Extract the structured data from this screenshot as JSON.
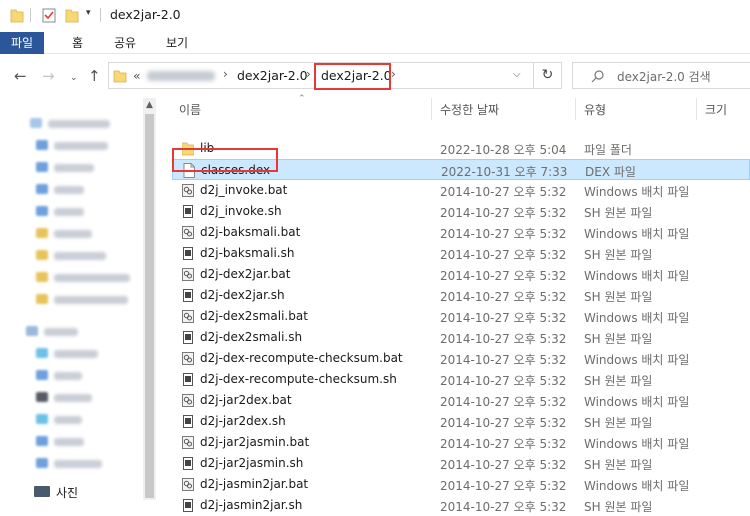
{
  "window": {
    "title": "dex2jar-2.0"
  },
  "ribbon": {
    "tabs": [
      "파일",
      "홈",
      "공유",
      "보기"
    ]
  },
  "address": {
    "crumbs": [
      "dex2jar-2.0",
      "dex2jar-2.0"
    ],
    "overflow_glyph": "«",
    "search_placeholder": "dex2jar-2.0 검색"
  },
  "columns": {
    "name": "이름",
    "date": "수정한 날짜",
    "type": "유형",
    "size": "크기"
  },
  "navpane": {
    "visible_label": "사진",
    "blurred_entries": 16
  },
  "files": [
    {
      "name": "lib",
      "date": "2022-10-28 오후 5:04",
      "type": "파일 폴더",
      "icon": "folder-icon"
    },
    {
      "name": "classes.dex",
      "date": "2022-10-31 오후 7:33",
      "type": "DEX 파일",
      "icon": "document-icon",
      "selected": true
    },
    {
      "name": "d2j_invoke.bat",
      "date": "2014-10-27 오후 5:32",
      "type": "Windows 배치 파일",
      "icon": "batch-file-icon"
    },
    {
      "name": "d2j_invoke.sh",
      "date": "2014-10-27 오후 5:32",
      "type": "SH 원본 파일",
      "icon": "script-file-icon"
    },
    {
      "name": "d2j-baksmali.bat",
      "date": "2014-10-27 오후 5:32",
      "type": "Windows 배치 파일",
      "icon": "batch-file-icon"
    },
    {
      "name": "d2j-baksmali.sh",
      "date": "2014-10-27 오후 5:32",
      "type": "SH 원본 파일",
      "icon": "script-file-icon"
    },
    {
      "name": "d2j-dex2jar.bat",
      "date": "2014-10-27 오후 5:32",
      "type": "Windows 배치 파일",
      "icon": "batch-file-icon"
    },
    {
      "name": "d2j-dex2jar.sh",
      "date": "2014-10-27 오후 5:32",
      "type": "SH 원본 파일",
      "icon": "script-file-icon"
    },
    {
      "name": "d2j-dex2smali.bat",
      "date": "2014-10-27 오후 5:32",
      "type": "Windows 배치 파일",
      "icon": "batch-file-icon"
    },
    {
      "name": "d2j-dex2smali.sh",
      "date": "2014-10-27 오후 5:32",
      "type": "SH 원본 파일",
      "icon": "script-file-icon"
    },
    {
      "name": "d2j-dex-recompute-checksum.bat",
      "date": "2014-10-27 오후 5:32",
      "type": "Windows 배치 파일",
      "icon": "batch-file-icon"
    },
    {
      "name": "d2j-dex-recompute-checksum.sh",
      "date": "2014-10-27 오후 5:32",
      "type": "SH 원본 파일",
      "icon": "script-file-icon"
    },
    {
      "name": "d2j-jar2dex.bat",
      "date": "2014-10-27 오후 5:32",
      "type": "Windows 배치 파일",
      "icon": "batch-file-icon"
    },
    {
      "name": "d2j-jar2dex.sh",
      "date": "2014-10-27 오후 5:32",
      "type": "SH 원본 파일",
      "icon": "script-file-icon"
    },
    {
      "name": "d2j-jar2jasmin.bat",
      "date": "2014-10-27 오후 5:32",
      "type": "Windows 배치 파일",
      "icon": "batch-file-icon"
    },
    {
      "name": "d2j-jar2jasmin.sh",
      "date": "2014-10-27 오후 5:32",
      "type": "SH 원본 파일",
      "icon": "script-file-icon"
    },
    {
      "name": "d2j-jasmin2jar.bat",
      "date": "2014-10-27 오후 5:32",
      "type": "Windows 배치 파일",
      "icon": "batch-file-icon"
    },
    {
      "name": "d2j-jasmin2jar.sh",
      "date": "2014-10-27 오후 5:32",
      "type": "SH 원본 파일",
      "icon": "script-file-icon"
    }
  ],
  "colors": {
    "accent": "#2b579a",
    "selection": "#cce8ff",
    "highlight_box": "#e53935",
    "folder": "#f8d775"
  }
}
